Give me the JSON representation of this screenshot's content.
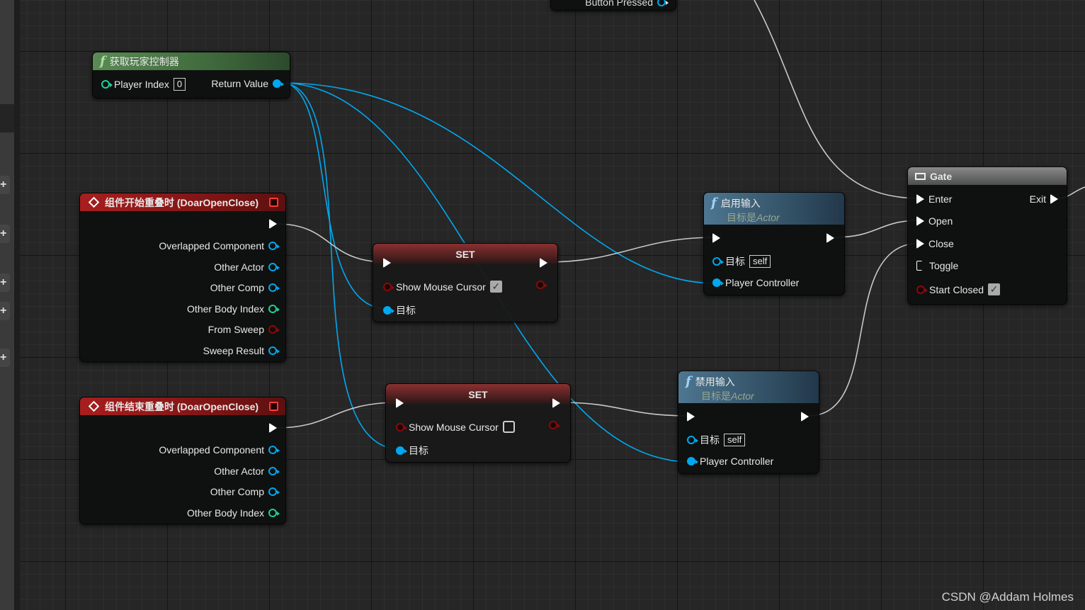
{
  "colors": {
    "object_wire": "#00a8f0",
    "exec_wire": "#c8c8c8",
    "pure_function_header": "#5c8a55",
    "event_header": "#a81e1e",
    "function_header": "#4e7690"
  },
  "top_node": {
    "pin_label": "Button Pressed"
  },
  "get_player_controller": {
    "title": "获取玩家控制器",
    "icon": "function-icon",
    "player_index_label": "Player Index",
    "player_index_value": "0",
    "return_label": "Return Value"
  },
  "begin_overlap": {
    "title": "组件开始重叠时 (DoarOpenClose)",
    "icon": "event-diamond-icon",
    "pins": [
      "Overlapped Component",
      "Other Actor",
      "Other Comp",
      "Other Body Index",
      "From Sweep",
      "Sweep Result"
    ]
  },
  "end_overlap": {
    "title": "组件结束重叠时 (DoarOpenClose)",
    "icon": "event-diamond-icon",
    "pins": [
      "Overlapped Component",
      "Other Actor",
      "Other Comp",
      "Other Body Index"
    ]
  },
  "set1": {
    "title": "SET",
    "var_label": "Show Mouse Cursor",
    "checked": true,
    "target_label": "目标"
  },
  "set2": {
    "title": "SET",
    "var_label": "Show Mouse Cursor",
    "checked": false,
    "target_label": "目标"
  },
  "enable_input": {
    "title": "启用输入",
    "subtitle_prefix": "目标是",
    "subtitle_class": "Actor",
    "target_label": "目标",
    "target_value": "self",
    "pc_label": "Player Controller"
  },
  "disable_input": {
    "title": "禁用输入",
    "subtitle_prefix": "目标是",
    "subtitle_class": "Actor",
    "target_label": "目标",
    "target_value": "self",
    "pc_label": "Player Controller"
  },
  "gate": {
    "title": "Gate",
    "enter": "Enter",
    "exit": "Exit",
    "open": "Open",
    "close": "Close",
    "toggle": "Toggle",
    "start_closed": "Start Closed",
    "start_closed_checked": true
  },
  "watermark": "CSDN @Addam Holmes"
}
